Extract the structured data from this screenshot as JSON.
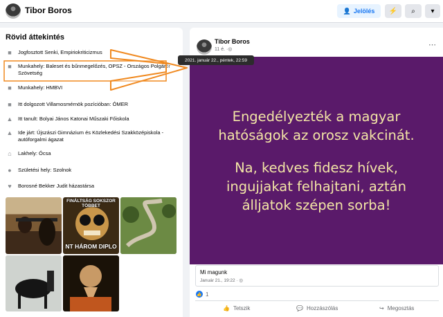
{
  "topbar": {
    "name": "Tibor Boros",
    "tag_label": "Jelölés",
    "tag_icon": "user-plus-icon",
    "messenger_icon": "messenger-icon",
    "search_icon": "search-icon",
    "more_icon": "chevron-down-icon"
  },
  "intro": {
    "title": "Rövid áttekintés",
    "items": [
      {
        "icon": "briefcase-icon",
        "text": "Jogfosztott Senki, Empiriokriticizmus"
      },
      {
        "icon": "briefcase-icon",
        "text": "Munkahely: Baleset és bűnmegelőzés, OPSZ - Országos Polgárőr Szövetség"
      },
      {
        "icon": "briefcase-icon",
        "text": "Munkahely: HMBVI"
      },
      {
        "icon": "briefcase-icon",
        "text": "Itt dolgozott Villamosmérnök pozícióban: ÓMER"
      },
      {
        "icon": "graduation-cap-icon",
        "text": "Itt tanult: Bolyai János Katonai Műszaki Főiskola"
      },
      {
        "icon": "graduation-cap-icon",
        "text": "Ide járt: Újszászi Gimnázium és Közlekedési Szakközépiskola - autóforgalmi ágazat"
      },
      {
        "icon": "home-icon",
        "text": "Lakhely: Ócsa"
      },
      {
        "icon": "location-pin-icon",
        "text": "Születési hely: Szolnok"
      },
      {
        "icon": "heart-icon",
        "text": "Borosné Bekker Judit házastársa"
      }
    ]
  },
  "photos": {
    "meme_top": "FINÁLTSÁG SOKSZOR TÖBBET",
    "meme_bottom": "NT HÁROM DIPLO"
  },
  "post": {
    "author": "Tibor Boros",
    "time_short": "11 é.",
    "tooltip": "2021. január 22., péntek, 22:59",
    "image_lines_1": [
      "Engedélyezték a magyar",
      "hatóságok az orosz vakcinát."
    ],
    "image_lines_2": [
      "Na, kedves fidesz hívek,",
      "ingujjakat felhajtani, aztán",
      "álljatok szépen sorba!"
    ],
    "link_title": "Mi magunk",
    "link_time": "Január 21., 19:22 ·",
    "likes": "1",
    "actions": {
      "like": "Tetszik",
      "comment": "Hozzászólás",
      "share": "Megosztás"
    }
  },
  "colors": {
    "accent": "#1877f2",
    "post_bg": "#5a1a6a",
    "post_text": "#f3e6a6",
    "arrow": "#f0891f"
  }
}
